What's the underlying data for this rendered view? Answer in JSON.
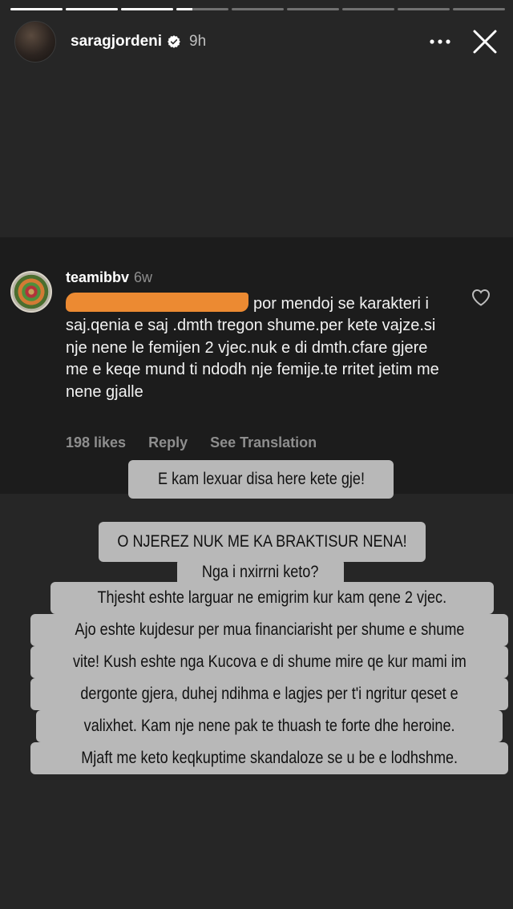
{
  "story": {
    "progress_segments": [
      1,
      1,
      1,
      0.3,
      0,
      0,
      0,
      0,
      0
    ],
    "username": "saragjordeni",
    "verified": true,
    "time": "9h"
  },
  "comment": {
    "username": "teamibbv",
    "time": "6w",
    "text": "por mendoj se karakteri i saj.qenia e saj .dmth tregon shume.per kete vajze.si nje nene le femijen 2 vjec.nuk e di dmth.cfare gjere me e keqe mund ti ndodh nje femije.te rritet jetim me nene gjalle",
    "likes": "198 likes",
    "reply_label": "Reply",
    "translation_label": "See Translation"
  },
  "captions": {
    "line1": "E kam lexuar disa here kete gje!",
    "line2": "O NJEREZ NUK ME KA BRAKTISUR NENA!",
    "line3": "Nga i nxirrni keto?",
    "block": [
      "Thjesht eshte larguar ne emigrim kur kam qene 2 vjec.",
      "Ajo eshte kujdesur per mua financiarisht per shume e shume",
      "vite! Kush eshte nga Kucova e di shume mire qe kur mami im",
      "dergonte gjera, duhej ndihma e lagjes per t'i ngritur qeset e",
      "valixhet. Kam nje nene pak te thuash te forte dhe heroine.",
      "Mjaft me keto keqkuptime skandaloze se u be e lodhshme."
    ]
  },
  "colors": {
    "background": "#262626",
    "card": "#1c1c1c",
    "caption_bg": "#b8b8b8",
    "redaction": "#ec8a32"
  }
}
